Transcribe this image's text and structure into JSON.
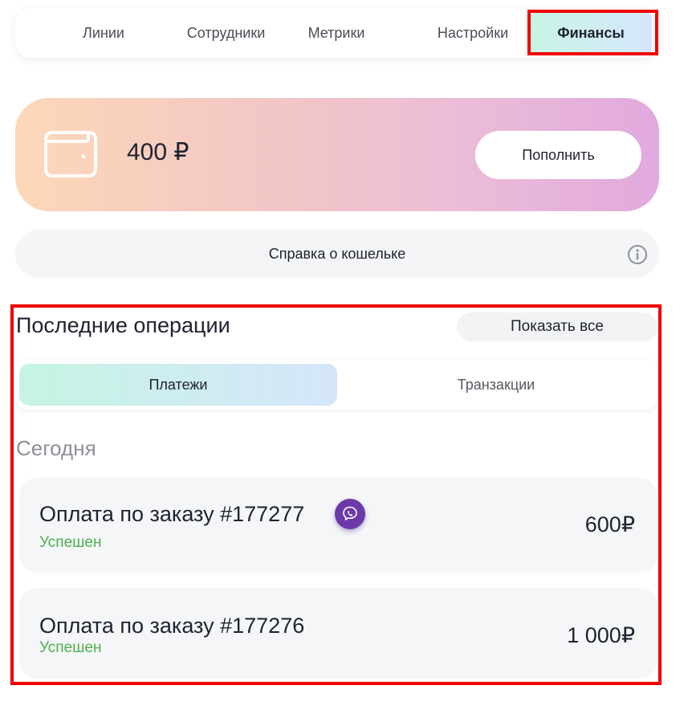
{
  "nav": {
    "tabs": [
      {
        "label": "Линии"
      },
      {
        "label": "Сотрудники"
      },
      {
        "label": "Метрики"
      },
      {
        "label": "Настройки"
      },
      {
        "label": "Финансы",
        "active": true
      }
    ]
  },
  "wallet": {
    "balance": "400 ₽",
    "topup_label": "Пополнить",
    "icon": "wallet-icon"
  },
  "help": {
    "label": "Справка о кошельке",
    "icon": "info-icon"
  },
  "operations": {
    "title": "Последние операции",
    "show_all_label": "Показать все",
    "tabs": [
      {
        "label": "Платежи",
        "active": true
      },
      {
        "label": "Транзакции"
      }
    ],
    "day_label": "Сегодня",
    "items": [
      {
        "title": "Оплата по заказу #177277",
        "status": "Успешен",
        "amount": "600₽",
        "channel_icon": "viber-icon"
      },
      {
        "title": "Оплата по заказу #177276",
        "status": "Успешен",
        "amount": "1 000₽"
      }
    ]
  },
  "colors": {
    "highlight": "#ee0000",
    "success": "#4caf50",
    "viber": "#6b3aa8",
    "active_tab_gradient": [
      "#c8f5e4",
      "#d6e6fb"
    ],
    "wallet_gradient": [
      "#fcd8b8",
      "#f3c6c6",
      "#ebbcd7",
      "#e1a9de"
    ]
  }
}
